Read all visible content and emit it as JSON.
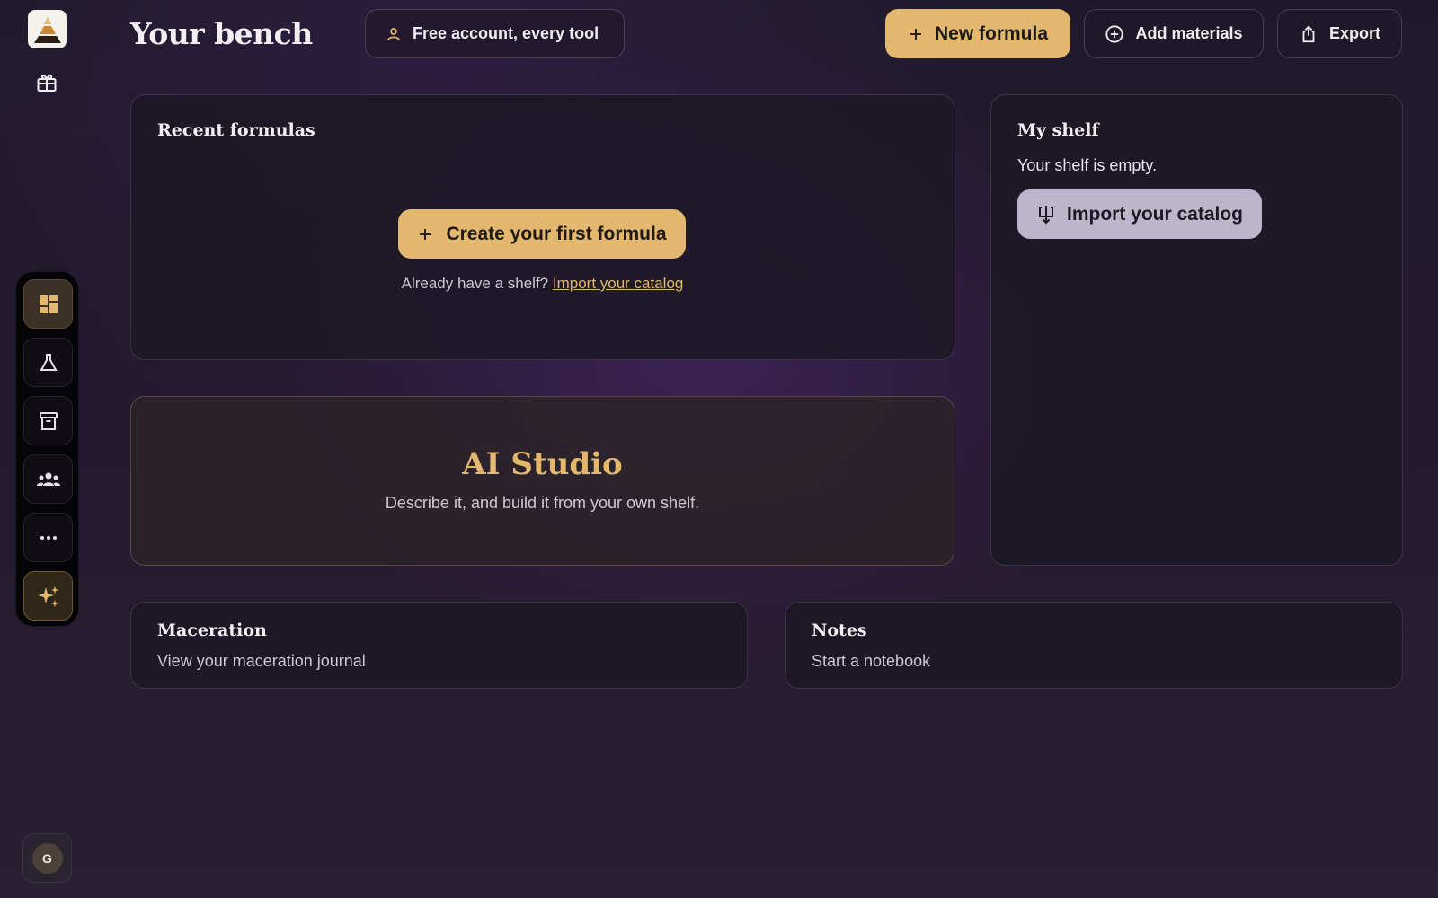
{
  "sidebar": {
    "avatar_initial": "G"
  },
  "header": {
    "title": "Your bench",
    "account_pill": "Free account, every tool",
    "new_formula": "New formula",
    "add_materials": "Add materials",
    "export": "Export"
  },
  "recent": {
    "title": "Recent formulas",
    "create_button": "Create your first formula",
    "already_text": "Already have a shelf?",
    "import_link": "Import your catalog"
  },
  "shelf": {
    "title": "My shelf",
    "empty_text": "Your shelf is empty.",
    "import_button": "Import your catalog"
  },
  "studio": {
    "title": "AI Studio",
    "subtitle": "Describe it, and build it from your own shelf."
  },
  "maceration": {
    "title": "Maceration",
    "subtitle": "View your maceration journal"
  },
  "notes": {
    "title": "Notes",
    "subtitle": "Start a notebook"
  },
  "colors": {
    "accent": "#e3b76d",
    "import_button_bg": "#bdb5cb"
  }
}
